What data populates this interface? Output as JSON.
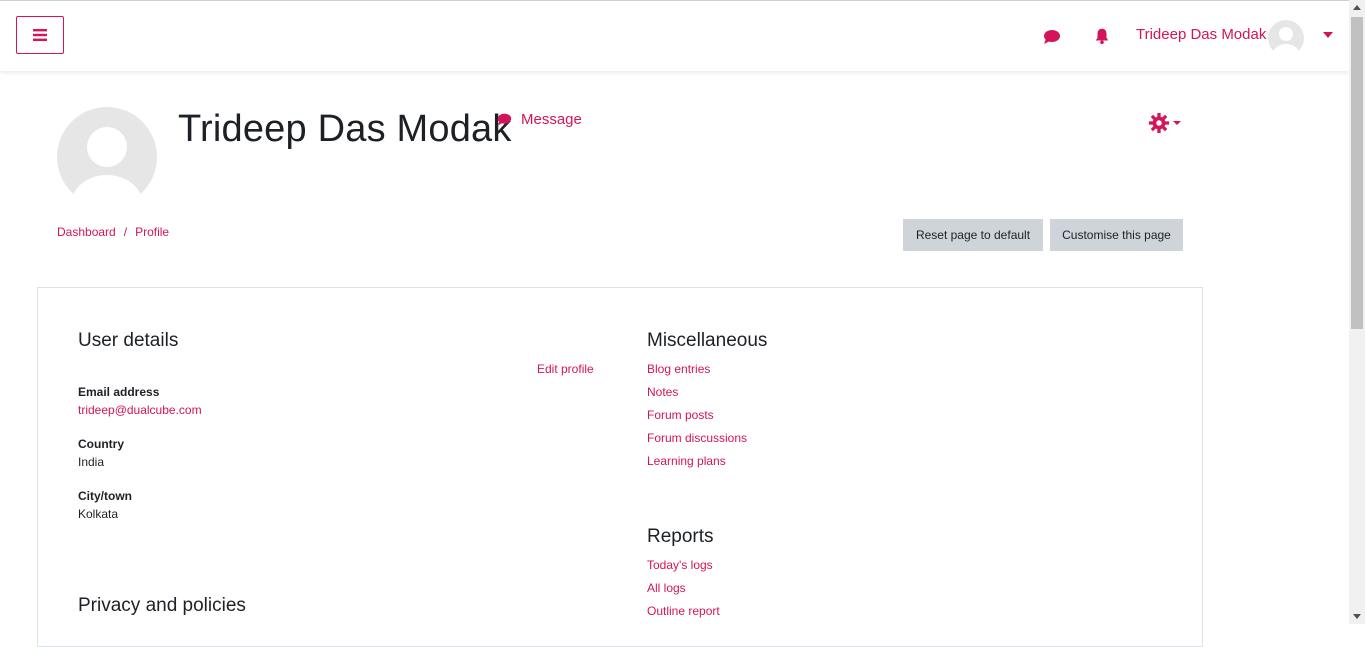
{
  "header": {
    "user_name": "Trideep Das Modak",
    "icons": [
      "menu-icon",
      "message-icon",
      "bell-icon",
      "chevron-down-icon"
    ],
    "accent_color": "#d4145a"
  },
  "profile": {
    "name": "Trideep Das Modak",
    "message_label": "Message"
  },
  "breadcrumb": {
    "items": [
      "Dashboard",
      "Profile"
    ],
    "separator": "/"
  },
  "buttons": {
    "reset": "Reset page to default",
    "customise": "Customise this page"
  },
  "user_details": {
    "title": "User details",
    "edit_profile": "Edit profile",
    "email_label": "Email address",
    "email_value": "trideep@dualcube.com",
    "country_label": "Country",
    "country_value": "India",
    "city_label": "City/town",
    "city_value": "Kolkata"
  },
  "privacy": {
    "title": "Privacy and policies"
  },
  "miscellaneous": {
    "title": "Miscellaneous",
    "links": [
      "Blog entries",
      "Notes",
      "Forum posts",
      "Forum discussions",
      "Learning plans"
    ]
  },
  "reports": {
    "title": "Reports",
    "links": [
      "Today's logs",
      "All logs",
      "Outline report"
    ]
  }
}
